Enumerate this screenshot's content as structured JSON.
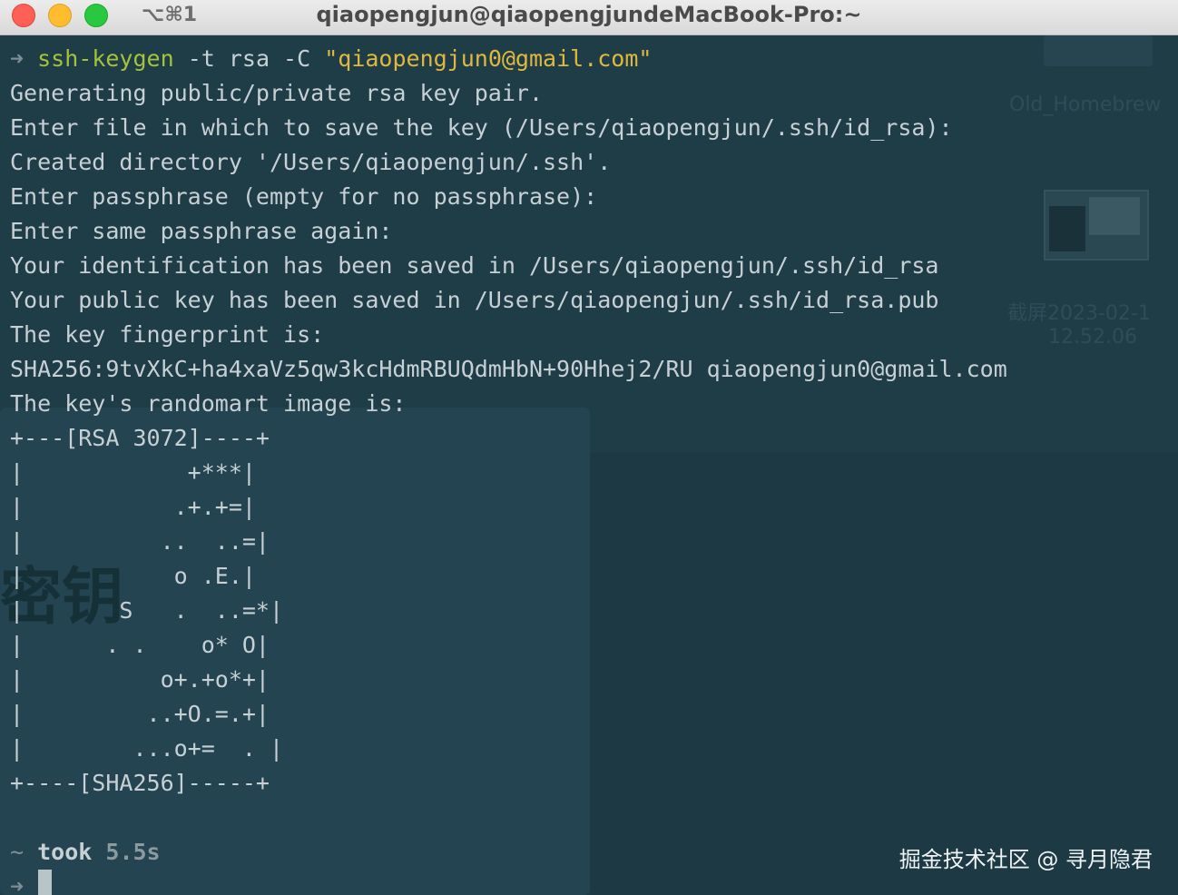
{
  "window": {
    "title": "qiaopengjun@qiaopengjundeMacBook-Pro:~",
    "tab_shortcut": "⌥⌘1"
  },
  "terminal": {
    "prompt_arrow": "➜",
    "command": {
      "program": "ssh-keygen",
      "args": " -t rsa -C ",
      "string_arg": "\"qiaopengjun0@gmail.com\""
    },
    "output_lines": [
      "Generating public/private rsa key pair.",
      "Enter file in which to save the key (/Users/qiaopengjun/.ssh/id_rsa):",
      "Created directory '/Users/qiaopengjun/.ssh'.",
      "Enter passphrase (empty for no passphrase):",
      "Enter same passphrase again:",
      "Your identification has been saved in /Users/qiaopengjun/.ssh/id_rsa",
      "Your public key has been saved in /Users/qiaopengjun/.ssh/id_rsa.pub",
      "The key fingerprint is:",
      "SHA256:9tvXkC+ha4xaVz5qw3kcHdmRBUQdmHbN+90Hhej2/RU qiaopengjun0@gmail.com",
      "The key's randomart image is:",
      "+---[RSA 3072]----+",
      "|            +***|",
      "|           .+.+=|",
      "|          ..  ..=|",
      "|           o .E.|",
      "|       S   .  ..=*|",
      "|      . .    o* O|",
      "|          o+.+o*+|",
      "|         ..+O.=.+|",
      "|        ...o+=  . |",
      "+----[SHA256]-----+"
    ],
    "status": {
      "tilde": "~",
      "took_label": "took",
      "duration": "5.5s"
    },
    "second_prompt_arrow": "➜"
  },
  "wallpaper": {
    "label_top": "Old_Homebrew",
    "label_date": "截屏2023-02-1",
    "label_time": "12.52.06",
    "big_text": "密钥"
  },
  "watermark": "掘金技术社区 @ 寻月隐君"
}
